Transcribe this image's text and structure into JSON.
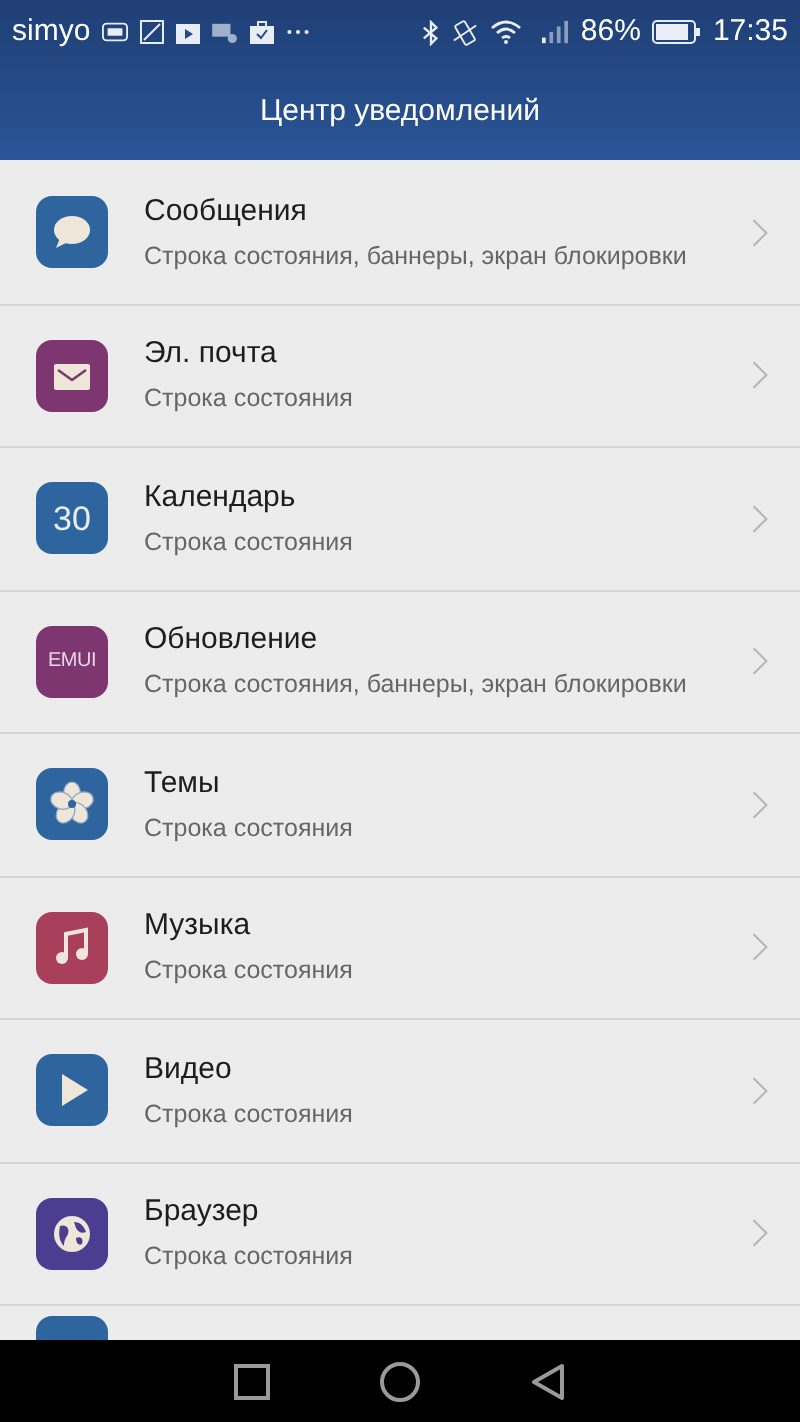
{
  "status_bar": {
    "carrier": "simyo",
    "battery_percent": "86%",
    "time": "17:35"
  },
  "header": {
    "title": "Центр уведомлений"
  },
  "items": [
    {
      "kind": "chat",
      "color": "#2f659e",
      "title": "Сообщения",
      "subtitle": "Строка состояния, баннеры, экран блокировки"
    },
    {
      "kind": "mail",
      "color": "#7d3670",
      "title": "Эл. почта",
      "subtitle": "Строка состояния"
    },
    {
      "kind": "calendar",
      "color": "#2f659e",
      "icon_text": "30",
      "title": "Календарь",
      "subtitle": "Строка состояния"
    },
    {
      "kind": "update",
      "color": "#7d3670",
      "icon_text": "EMUI",
      "title": "Обновление",
      "subtitle": "Строка состояния, баннеры, экран блокировки"
    },
    {
      "kind": "themes",
      "color": "#2f659e",
      "title": "Темы",
      "subtitle": "Строка состояния"
    },
    {
      "kind": "music",
      "color": "#a8405c",
      "title": "Музыка",
      "subtitle": "Строка состояния"
    },
    {
      "kind": "video",
      "color": "#2f659e",
      "title": "Видео",
      "subtitle": "Строка состояния"
    },
    {
      "kind": "browser",
      "color": "#4b3d8f",
      "title": "Браузер",
      "subtitle": "Строка состояния"
    }
  ]
}
